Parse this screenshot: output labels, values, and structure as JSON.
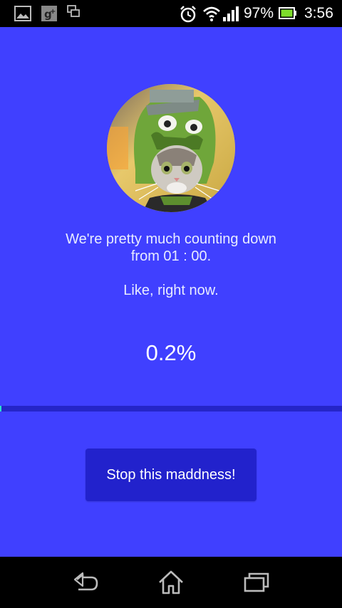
{
  "status_bar": {
    "battery_percent": "97%",
    "time": "3:56",
    "icons": [
      "gallery-icon",
      "google-plus-icon",
      "multi-window-icon",
      "alarm-icon",
      "wifi-icon",
      "signal-icon",
      "battery-icon"
    ]
  },
  "colors": {
    "background": "#4040ff",
    "button": "#2222cc",
    "progress_track": "#2525c8",
    "progress_fill": "#27e0d0"
  },
  "main": {
    "avatar_icon": "cat-in-costume-avatar",
    "line1": "We're pretty much counting down",
    "line2": "from 01 : 00.",
    "line3": "Like, right now.",
    "progress_text": "0.2%",
    "progress_value": 0.002,
    "stop_button_label": "Stop this maddness!"
  },
  "nav_bar": {
    "icons": [
      "back-icon",
      "home-icon",
      "recent-apps-icon"
    ]
  }
}
